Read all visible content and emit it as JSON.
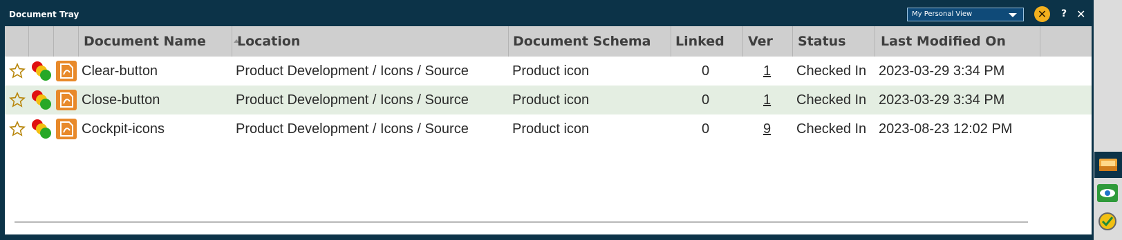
{
  "window": {
    "title": "Document Tray",
    "view_select_value": "My Personal View",
    "clear_label": "✕",
    "help_label": "?",
    "close_label": "✕"
  },
  "columns": {
    "name": "Document Name",
    "location": "Location",
    "schema": "Document Schema",
    "linked": "Linked",
    "ver": "Ver",
    "status": "Status",
    "modified": "Last Modified On"
  },
  "rows": [
    {
      "name": "Clear-button",
      "location": "Product Development / Icons / Source",
      "schema": "Product icon",
      "linked": "0",
      "ver": "1",
      "status": "Checked In",
      "modified": "2023-03-29 3:34 PM"
    },
    {
      "name": "Close-button",
      "location": "Product Development / Icons / Source",
      "schema": "Product icon",
      "linked": "0",
      "ver": "1",
      "status": "Checked In",
      "modified": "2023-03-29 3:34 PM"
    },
    {
      "name": "Cockpit-icons",
      "location": "Product Development / Icons / Source",
      "schema": "Product icon",
      "linked": "0",
      "ver": "9",
      "status": "Checked In",
      "modified": "2023-08-23 12:02 PM"
    }
  ],
  "icons": {
    "favorite": "star-outline-icon",
    "status": "traffic-light-icon",
    "filetype": "orange-file-icon",
    "rail": [
      "document-tray-icon",
      "eye-icon",
      "approval-check-icon"
    ]
  },
  "colors": {
    "titlebar": "#0c3348",
    "alt_row": "#e4eee2",
    "header": "#cfcfcf",
    "accent_orange": "#f2b01e"
  }
}
